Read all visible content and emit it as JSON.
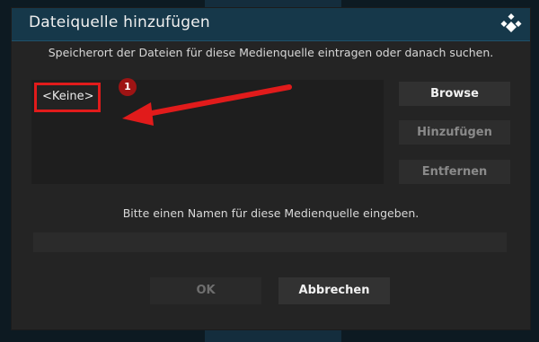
{
  "dialog": {
    "title": "Dateiquelle hinzufügen",
    "instruction": "Speicherort der Dateien für diese Medienquelle eintragen oder danach suchen.",
    "name_prompt": "Bitte einen Namen für diese Medienquelle eingeben.",
    "name_value": ""
  },
  "sources": {
    "items": [
      {
        "label": "<Keine>"
      }
    ]
  },
  "side_buttons": {
    "browse": "Browse",
    "add": "Hinzufügen",
    "remove": "Entfernen"
  },
  "bottom_buttons": {
    "ok": "OK",
    "cancel": "Abbrechen"
  },
  "annotation": {
    "marker": "1",
    "highlight_color": "#e11b1b"
  },
  "icons": {
    "logo": "kodi-logo-icon"
  }
}
